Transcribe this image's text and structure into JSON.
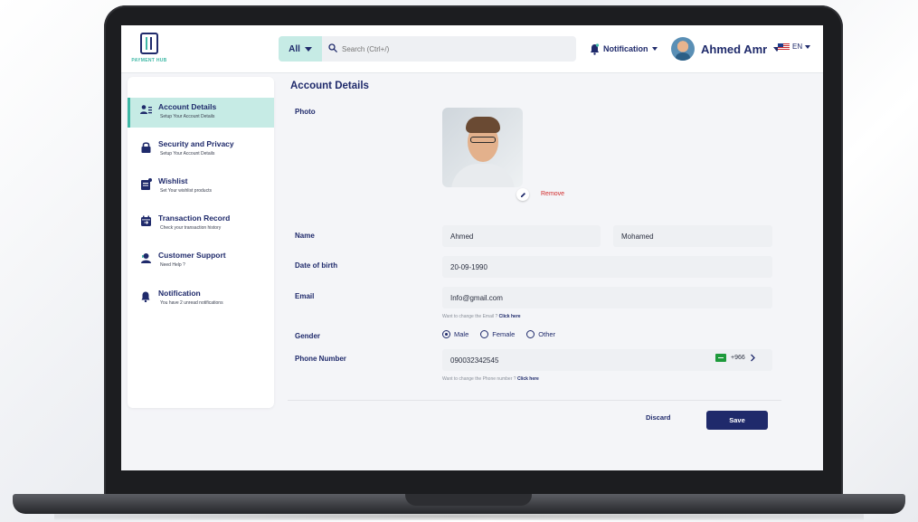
{
  "header": {
    "logo_text": "PAYMENT HUB",
    "search_category": "All",
    "search_placeholder": "Search (Ctrl+/)",
    "notification_label": "Notification",
    "user_name": "Ahmed Amr",
    "language": "EN"
  },
  "sidebar": {
    "items": [
      {
        "title": "Account Details",
        "subtitle": "Setup Your Account Details"
      },
      {
        "title": "Security and Privacy",
        "subtitle": "Setup Your Account Details"
      },
      {
        "title": "Wishlist",
        "subtitle": "Set Your wishlist products"
      },
      {
        "title": "Transaction Record",
        "subtitle": "Check your transaction history"
      },
      {
        "title": "Customer Support",
        "subtitle": "Need Help ?"
      },
      {
        "title": "Notification",
        "subtitle": "You have 2 unread notifications"
      }
    ]
  },
  "main": {
    "title": "Account Details",
    "labels": {
      "photo": "Photo",
      "name": "Name",
      "dob": "Date of birth",
      "email": "Email",
      "gender": "Gender",
      "phone": "Phone Number"
    },
    "remove_label": "Remove",
    "first_name": "Ahmed",
    "last_name": "Mohamed",
    "dob_value": "20-09-1990",
    "email_value": "Info@gmail.com",
    "email_hint": "Want to change the Email ?",
    "email_hint_link": "Click here",
    "gender_options": [
      "Male",
      "Female",
      "Other"
    ],
    "gender_selected": "Male",
    "phone_value": "090032342545",
    "phone_code": "+966",
    "phone_hint": "Want to change the Phone number ?",
    "phone_hint_link": "Click here",
    "discard_label": "Discard",
    "save_label": "Save"
  },
  "colors": {
    "primary": "#1f2a6b",
    "accent": "#3fb8a6",
    "accent_light": "#c6ebe5",
    "danger": "#d12c2c"
  }
}
